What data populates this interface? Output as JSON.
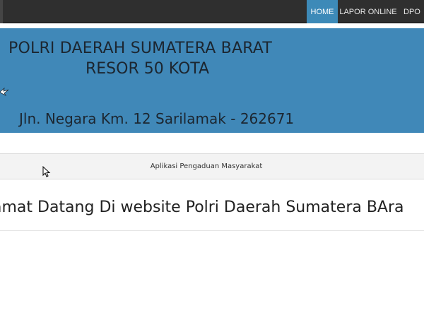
{
  "nav": {
    "items": [
      {
        "label": "HOME",
        "active": true
      },
      {
        "label": "LAPOR ONLINE",
        "active": false
      },
      {
        "label": "DPO",
        "active": false
      }
    ]
  },
  "banner": {
    "title_line1": "POLRI DAERAH SUMATERA BARAT",
    "title_line2": "RESOR 50 KOTA",
    "address": "Jln. Negara Km. 12 Sarilamak - 262671",
    "logo_icon": "police-emblem-icon"
  },
  "subbar": {
    "text": "Aplikasi Pengaduan Masyarakat"
  },
  "main": {
    "welcome_text": "amat Datang Di website Polri Daerah Sumatera BAra"
  },
  "colors": {
    "topbar": "#2f2f2f",
    "accent": "#3d8ab8",
    "banner": "#4088b8"
  }
}
